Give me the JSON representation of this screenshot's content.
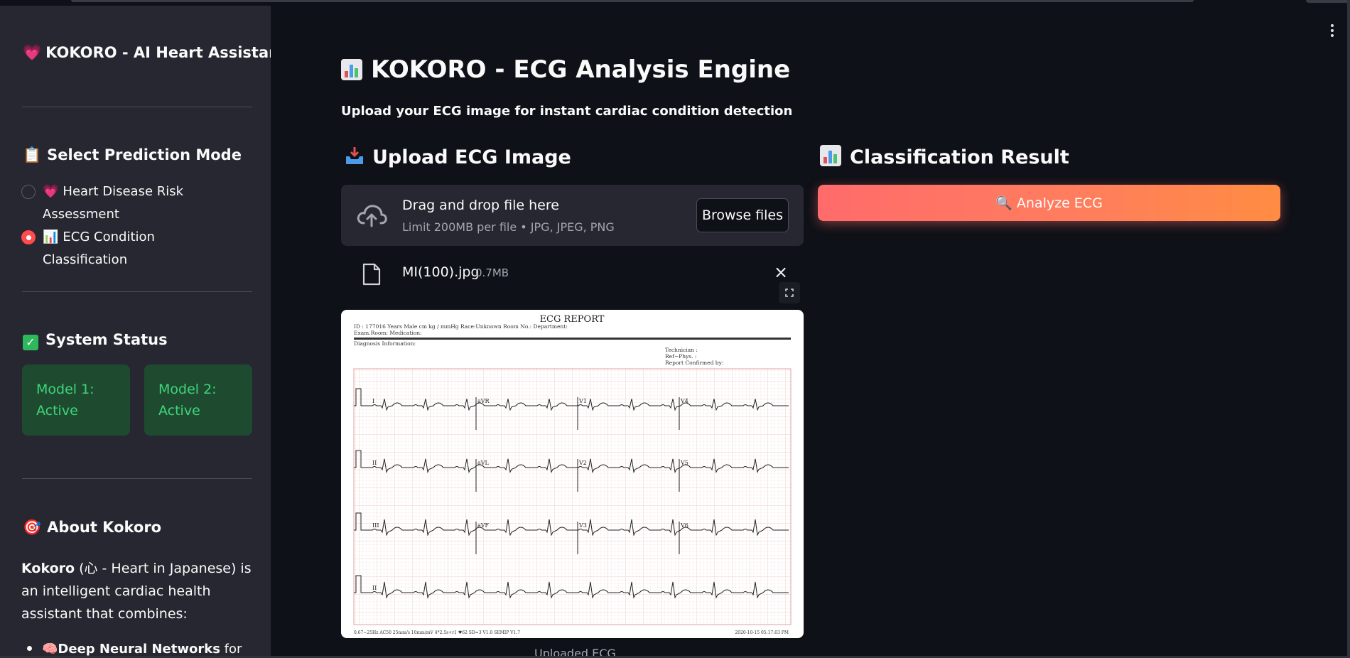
{
  "sidebar": {
    "title": "KOKORO - AI Heart Assistant",
    "mode_heading": "Select Prediction Mode",
    "modes": [
      {
        "label": "Heart Disease Risk Assessment",
        "selected": false
      },
      {
        "label": "ECG Condition Classification",
        "selected": true
      }
    ],
    "status_heading": "System Status",
    "status_cards": [
      {
        "label": "Model 1: Active"
      },
      {
        "label": "Model 2: Active"
      }
    ],
    "about_heading": "About Kokoro",
    "about_name": "Kokoro",
    "about_text": " (心 - Heart in Japanese) is an intelligent cardiac health assistant that combines:",
    "about_items": [
      {
        "bold": "Deep Neural Networks",
        "text": " for heart"
      }
    ]
  },
  "main": {
    "title": "KOKORO - ECG Analysis Engine",
    "subtitle": "Upload your ECG image for instant cardiac condition detection",
    "upload_heading": "Upload ECG Image",
    "result_heading": "Classification Result",
    "uploader": {
      "title": "Drag and drop file here",
      "limit": "Limit 200MB per file • JPG, JPEG, PNG",
      "browse_label": "Browse files"
    },
    "file": {
      "name": "MI(100).jpg",
      "size": "0.7MB"
    },
    "caption": "Uploaded ECG",
    "analyze_label": "🔍 Analyze ECG"
  },
  "ecg_report": {
    "title": "ECG  REPORT",
    "header_line1": "ID : 177016        Years     Male          cm           kg            /      mmHg     Race:Unknown      Room  No.:      Department:",
    "header_line2": "Exam.Room:     Medication:",
    "diagnosis": "Diagnosis  Information:",
    "technician": "Technician :",
    "ref_phys": "Ref~Phys.  :",
    "confirmed": "Report  Confirmed  by:",
    "leads": [
      "I",
      "aVR",
      "V1",
      "V4",
      "II",
      "aVL",
      "V2",
      "V5",
      "III",
      "aVF",
      "V3",
      "V6",
      "II"
    ],
    "footer_left": "0.67~25Hz  AC50  25mm/s  10mm/mV  4*2.5s+r1  ♥62   SD=3  V1.0  SEMIP  V1.7",
    "footer_right": "2020-10-15   05:17:03  PM"
  },
  "colors": {
    "background": "#0e1117",
    "sidebar": "#262730",
    "accent": "#ff4b4b",
    "status_card": "#1e4b30",
    "status_text": "#3fd47a",
    "button_gradient_start": "#ff6b6b",
    "button_gradient_end": "#ff8c42"
  },
  "icons": {
    "title_icon": "heart-icon",
    "mode_icon": "clipboard-icon",
    "status_icon": "checkmark-icon",
    "about_icon": "target-icon",
    "chart_icon": "bar-chart-icon",
    "upload_icon": "inbox-tray-icon",
    "cloud_icon": "cloud-upload-icon",
    "file_icon": "file-icon"
  }
}
